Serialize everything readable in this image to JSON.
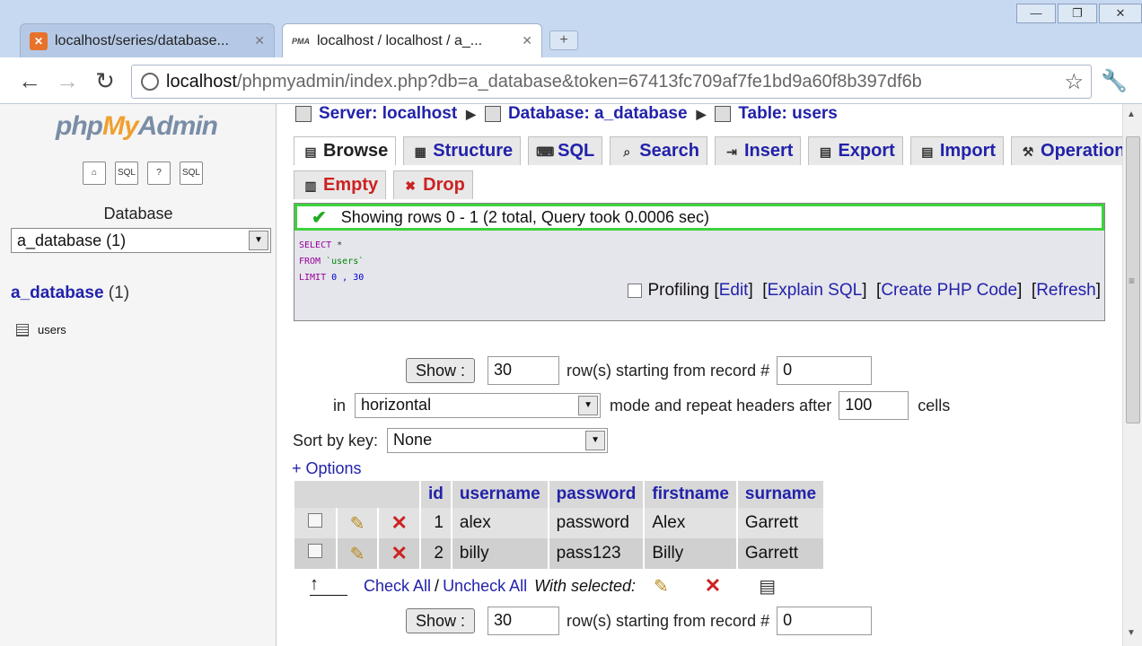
{
  "browser": {
    "tabs": [
      {
        "title": "localhost/series/database...",
        "favicon": "xampp-icon"
      },
      {
        "title": "localhost / localhost / a_...",
        "favicon": "pma-icon"
      }
    ],
    "url_host": "localhost",
    "url_path": "/phpmyadmin/index.php?db=a_database&token=67413fc709af7fe1bd9a60f8b397df6b"
  },
  "left": {
    "logo_php": "php",
    "logo_my": "My",
    "logo_admin": "Admin",
    "database_label": "Database",
    "database_select": "a_database (1)",
    "db_link": "a_database",
    "db_count": "(1)",
    "tables": [
      "users"
    ]
  },
  "main": {
    "breadcrumb": {
      "server": "Server: localhost",
      "database": "Database: a_database",
      "table": "Table: users"
    },
    "tabs": [
      "Browse",
      "Structure",
      "SQL",
      "Search",
      "Insert",
      "Export",
      "Import",
      "Operations"
    ],
    "tabs2": [
      "Empty",
      "Drop"
    ],
    "success_msg": "Showing rows 0 - 1 (2 total, Query took 0.0006 sec)",
    "sql": {
      "select": "SELECT",
      "select_arg": "*",
      "from": "FROM",
      "from_arg": "`users`",
      "limit": "LIMIT",
      "limit_arg": "0 , 30"
    },
    "sql_actions": {
      "profiling": "Profiling",
      "edit": "Edit",
      "explain": "Explain SQL",
      "create_php": "Create PHP Code",
      "refresh": "Refresh"
    },
    "nav": {
      "show_btn": "Show :",
      "rows": "30",
      "starting_text": "row(s) starting from record #",
      "start": "0",
      "in_text": "in",
      "mode": "horizontal",
      "repeat_text": "mode and repeat headers after",
      "repeat": "100",
      "cells_text": "cells",
      "sort_label": "Sort by key:",
      "sort_value": "None"
    },
    "options_link": "+ Options",
    "table": {
      "headers": [
        "id",
        "username",
        "password",
        "firstname",
        "surname"
      ],
      "rows": [
        [
          "1",
          "alex",
          "password",
          "Alex",
          "Garrett"
        ],
        [
          "2",
          "billy",
          "pass123",
          "Billy",
          "Garrett"
        ]
      ]
    },
    "check_all": "Check All",
    "slash": "/",
    "uncheck_all": "Uncheck All",
    "with_selected": "With selected:",
    "nav_bottom": {
      "show_btn": "Show :",
      "rows": "30",
      "starting_text": "row(s) starting from record #",
      "start": "0"
    }
  }
}
